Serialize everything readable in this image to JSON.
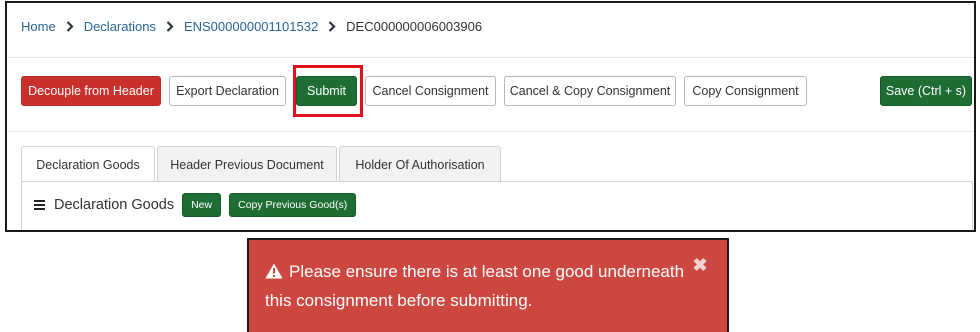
{
  "breadcrumb": {
    "home": "Home",
    "declarations": "Declarations",
    "consignment": "ENS000000001101532",
    "current": "DEC000000006003906"
  },
  "toolbar": {
    "decouple_label": "Decouple from Header",
    "export_label": "Export Declaration",
    "submit_label": "Submit",
    "cancel_consignment_label": "Cancel Consignment",
    "cancel_copy_label": "Cancel & Copy Consignment",
    "copy_consignment_label": "Copy Consignment",
    "save_label": "Save (Ctrl + s)"
  },
  "tabs": [
    {
      "label": "Declaration Goods",
      "active": true
    },
    {
      "label": "Header Previous Document",
      "active": false
    },
    {
      "label": "Holder Of Authorisation",
      "active": false
    }
  ],
  "panel": {
    "title": "Declaration Goods",
    "new_label": "New",
    "copy_previous_label": "Copy Previous Good(s)"
  },
  "alert": {
    "message": "Please ensure there is at least one good underneath this consignment before submitting.",
    "icon": "warning-icon",
    "close_icon": "close-icon"
  },
  "colors": {
    "danger": "#c9302c",
    "success": "#1e6e34",
    "link": "#2a6496",
    "highlight": "#e0111c",
    "alert_bg": "#cc4740"
  }
}
